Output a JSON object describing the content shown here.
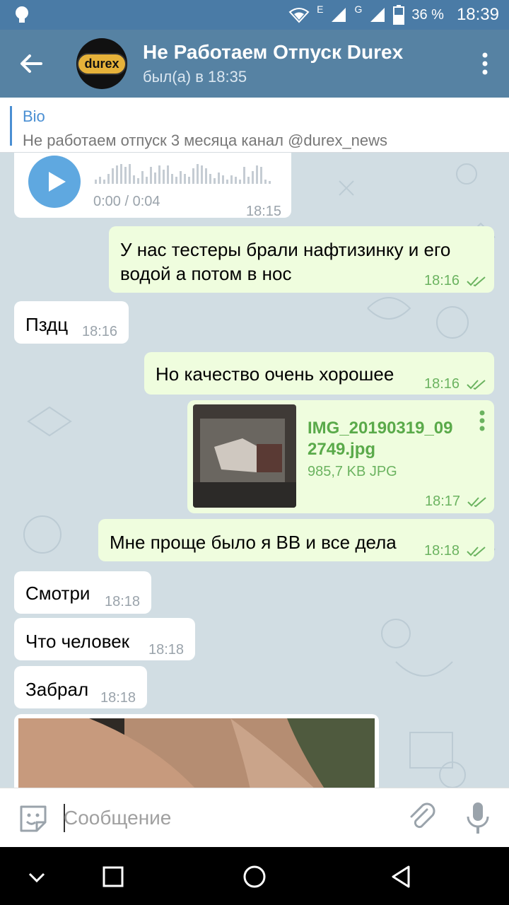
{
  "status_bar": {
    "network_e": "E",
    "network_g": "G",
    "battery_percent": "36 %",
    "time": "18:39"
  },
  "header": {
    "avatar_logo": "durex",
    "title": "Не Работаем Отпуск Durex",
    "subtitle": "был(а) в 18:35"
  },
  "bio": {
    "label": "Bio",
    "text": "Не работаем отпуск 3 месяца канал @durex_news"
  },
  "messages": {
    "voice": {
      "duration": "0:00 / 0:04",
      "time": "18:15"
    },
    "m1": {
      "text_line1": "У нас  тестеры брали нафтизинку и его",
      "text_line2": "водой а потом в нос",
      "time": "18:16"
    },
    "m2": {
      "text": "Пздц",
      "time": "18:16"
    },
    "m3": {
      "text": "Но качество очень хорошее",
      "time": "18:16"
    },
    "file": {
      "name_line1": "IMG_20190319_09",
      "name_line2": "2749.jpg",
      "meta": "985,7 KB JPG",
      "time": "18:17"
    },
    "m4": {
      "text": "Мне проще было я ВВ и все дела",
      "time": "18:18"
    },
    "m5": {
      "text": "Смотри",
      "time": "18:18"
    },
    "m6": {
      "text": "Что человек",
      "time": "18:18"
    },
    "m7": {
      "text": "Забрал",
      "time": "18:18"
    }
  },
  "input": {
    "placeholder": "Сообщение"
  },
  "colors": {
    "header": "#5682a3",
    "status_bar": "#4a7ba6",
    "outgoing_bubble": "#effdde",
    "incoming_bubble": "#ffffff",
    "accent": "#4a8fd3",
    "read_check": "#6bb360"
  },
  "icons": {
    "back": "arrow-left-icon",
    "menu": "more-vertical-icon",
    "play": "play-icon",
    "emoji": "sticker-icon",
    "attach": "paperclip-icon",
    "mic": "microphone-icon"
  }
}
